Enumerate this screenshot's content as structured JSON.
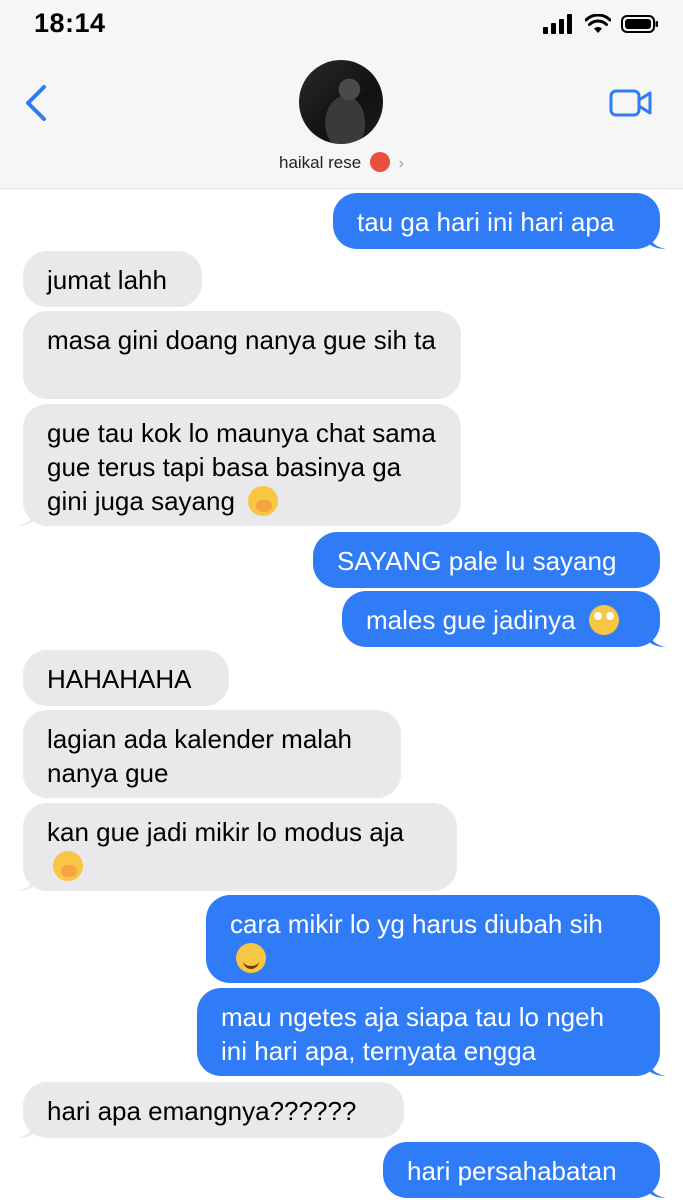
{
  "status": {
    "time": "18:14"
  },
  "contact": {
    "name": "haikal rese",
    "chevron": "›"
  },
  "icons": {
    "back": "chevron-left-icon",
    "video": "video-camera-icon",
    "signal": "signal-icon",
    "wifi": "wifi-icon",
    "battery": "battery-icon"
  },
  "colors": {
    "sent_bubble": "#2f7cf6",
    "received_bubble": "#e9e9eb",
    "accent": "#2f7cf6"
  },
  "messages": [
    {
      "from": "me",
      "text": "tau ga hari ini hari apa"
    },
    {
      "from": "them",
      "text": "jumat lahh"
    },
    {
      "from": "them",
      "text": "masa gini doang nanya gue sih ta"
    },
    {
      "from": "them",
      "text": "gue tau kok lo maunya chat sama gue terus tapi basa basinya ga gini juga sayang",
      "emoji": "hand-over-mouth-face"
    },
    {
      "from": "me",
      "text": "SAYANG pale lu sayang"
    },
    {
      "from": "me",
      "text": "males gue jadinya",
      "emoji": "rolling-eyes-face"
    },
    {
      "from": "them",
      "text": "HAHAHAHA"
    },
    {
      "from": "them",
      "text": "lagian ada kalender malah nanya gue"
    },
    {
      "from": "them",
      "text": "kan gue jadi mikir lo modus aja",
      "emoji": "hand-over-mouth-face"
    },
    {
      "from": "me",
      "text": "cara mikir lo yg harus diubah sih",
      "emoji": "smiling-face"
    },
    {
      "from": "me",
      "text": "mau ngetes aja siapa tau lo ngeh ini hari apa, ternyata engga"
    },
    {
      "from": "them",
      "text": "hari apa emangnya??????"
    },
    {
      "from": "me",
      "text": "hari persahabatan"
    }
  ]
}
